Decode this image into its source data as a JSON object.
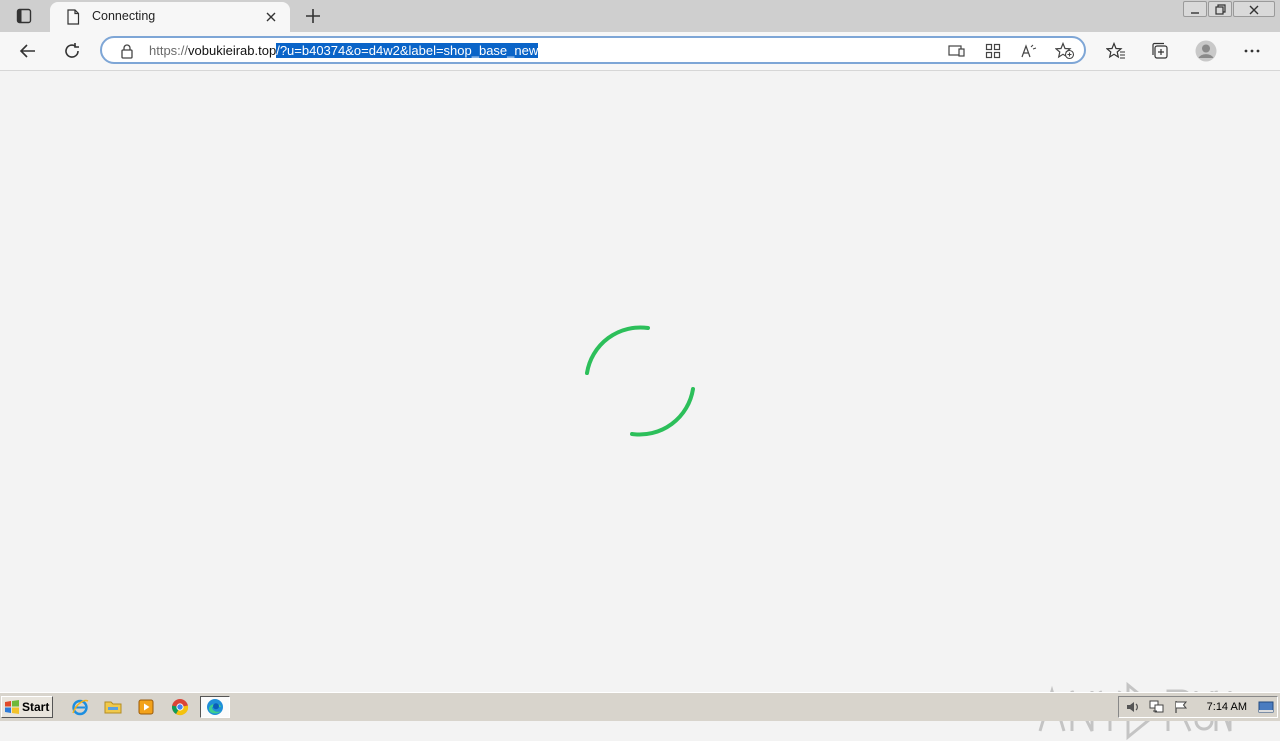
{
  "browser": {
    "tab": {
      "title": "Connecting"
    },
    "address": {
      "scheme": "https://",
      "host": "vobukieirab.top",
      "query": "/?u=b40374&o=d4w2&label=shop_base_new"
    }
  },
  "page": {
    "state": "loading",
    "spinner_color": "#2cbf5a",
    "watermark": "ANY RUN"
  },
  "taskbar": {
    "start_label": "Start",
    "apps": [
      "ie-icon",
      "folder-icon",
      "media-player-icon",
      "chrome-icon",
      "edge-icon"
    ],
    "clock": "7:14 AM"
  }
}
